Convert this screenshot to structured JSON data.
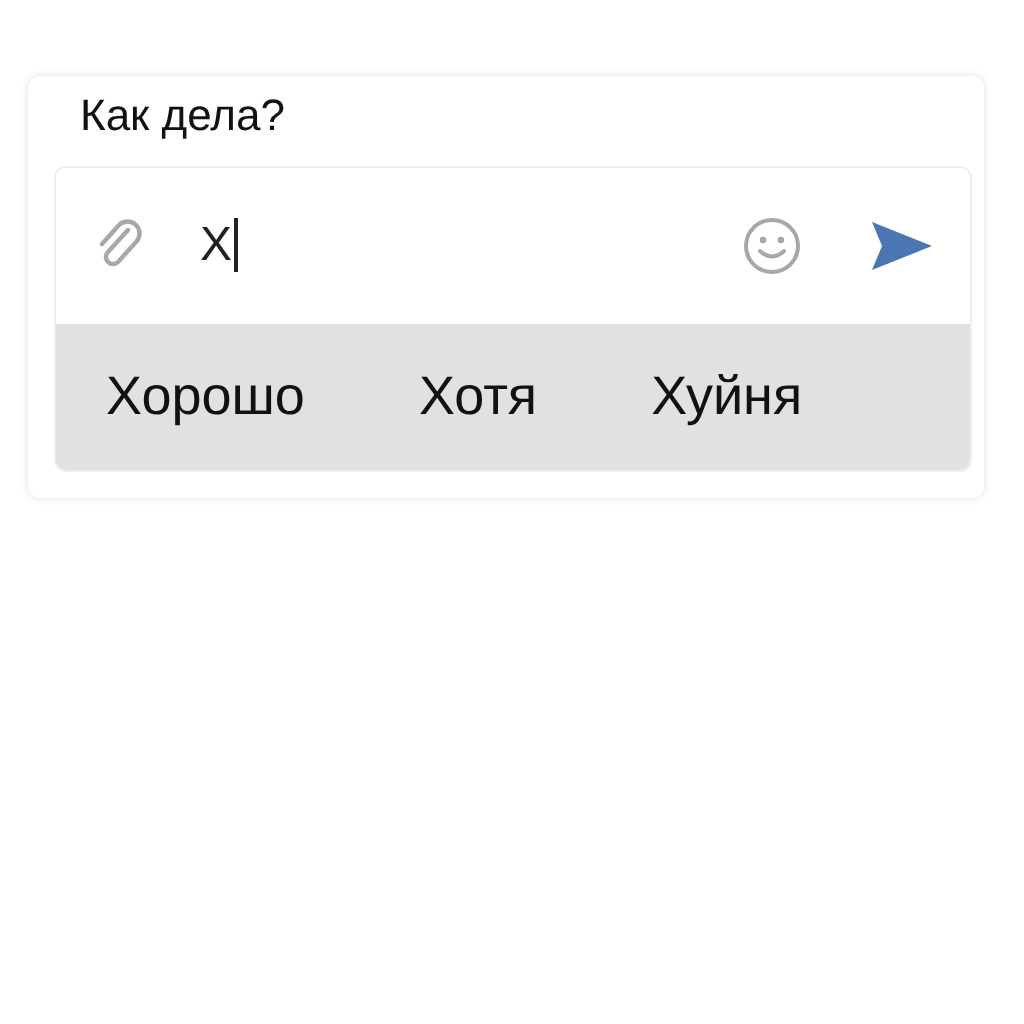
{
  "message": {
    "text": "Как дела?"
  },
  "composer": {
    "value": "Х"
  },
  "suggestions": [
    {
      "label": "Хорошо"
    },
    {
      "label": "Хотя"
    },
    {
      "label": "Хуйня"
    }
  ]
}
